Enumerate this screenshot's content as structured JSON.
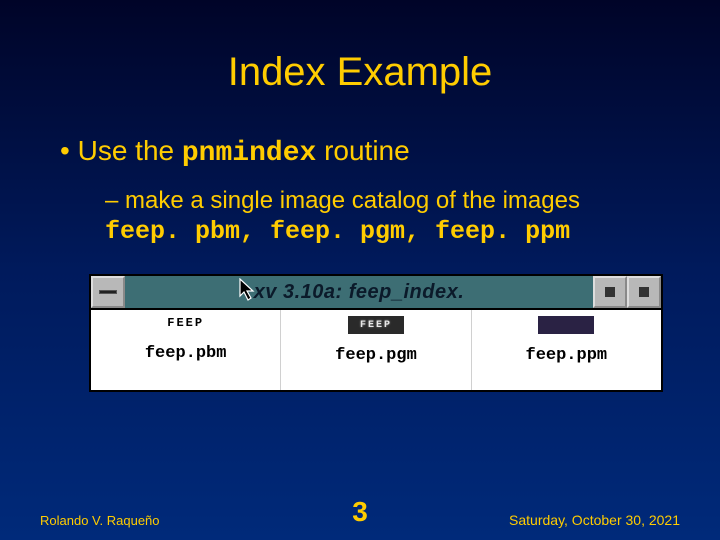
{
  "title": "Index Example",
  "bullet1_prefix": "Use the ",
  "bullet1_code": "pnmindex",
  "bullet1_suffix": " routine",
  "bullet2": "make a single image catalog of the images",
  "files_line": "feep. pbm, feep. pgm, feep. ppm",
  "xv": {
    "title": "xv 3.10a: feep_index.",
    "thumb_pbm_text": "FEEP",
    "thumb_pgm_text": "FEEP",
    "cells": [
      {
        "label": "feep.pbm"
      },
      {
        "label": "feep.pgm"
      },
      {
        "label": "feep.ppm"
      }
    ]
  },
  "footer": {
    "author": "Rolando V. Raqueño",
    "page": "3",
    "date": "Saturday, October 30, 2021"
  }
}
